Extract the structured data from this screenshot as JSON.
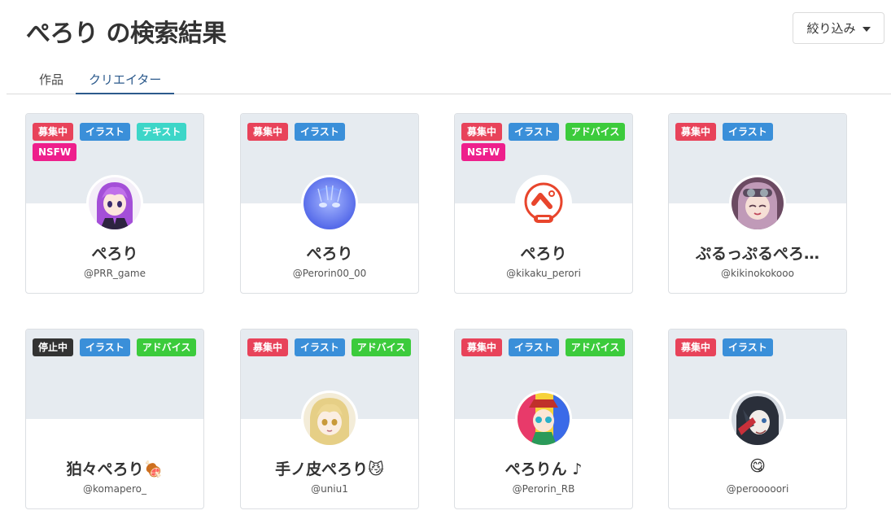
{
  "page": {
    "title": "ぺろり の検索結果",
    "filter_label": "絞り込み"
  },
  "tabs": [
    {
      "label": "作品",
      "active": false
    },
    {
      "label": "クリエイター",
      "active": true
    }
  ],
  "tag_colors": {
    "募集中": "#e8435a",
    "停止中": "#333333",
    "イラスト": "#3a8fd9",
    "テキスト": "#3dd6c8",
    "NSFW": "#ee1f8c",
    "アドバイス": "#3ccb3c"
  },
  "creators": [
    {
      "name": "ぺろり",
      "handle": "@PRR_game",
      "tags": [
        "募集中",
        "イラスト",
        "テキスト",
        "NSFW"
      ],
      "avatar": "purple-hair-girl-avatar"
    },
    {
      "name": "ぺろり",
      "handle": "@Perorin00_00",
      "tags": [
        "募集中",
        "イラスト"
      ],
      "avatar": "blue-glow-avatar"
    },
    {
      "name": "ぺろり",
      "handle": "@kikaku_perori",
      "tags": [
        "募集中",
        "イラスト",
        "アドバイス",
        "NSFW"
      ],
      "avatar": "perori-logo-avatar"
    },
    {
      "name": "ぷるっぷるぺろ…",
      "handle": "@kikinokokooo",
      "tags": [
        "募集中",
        "イラスト"
      ],
      "avatar": "goggles-girl-avatar"
    },
    {
      "name": "狛々ぺろり🍖",
      "handle": "@komapero_",
      "tags": [
        "停止中",
        "イラスト",
        "アドバイス"
      ],
      "avatar": "none"
    },
    {
      "name": "手ノ皮ぺろり😼",
      "handle": "@uniu1",
      "tags": [
        "募集中",
        "イラスト",
        "アドバイス"
      ],
      "avatar": "blonde-girl-avatar"
    },
    {
      "name": "ぺろりん ♪",
      "handle": "@Perorin_RB",
      "tags": [
        "募集中",
        "イラスト",
        "アドバイス"
      ],
      "avatar": "colorful-character-avatar"
    },
    {
      "name": "😋",
      "handle": "@perooooori",
      "tags": [
        "募集中",
        "イラスト"
      ],
      "avatar": "dark-haired-character-avatar"
    }
  ]
}
